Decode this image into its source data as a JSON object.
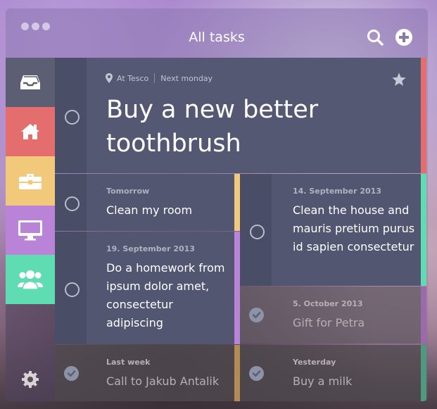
{
  "window": {
    "title": "All tasks"
  },
  "toolbar": {
    "search_icon": "search-icon",
    "add_icon": "plus-circle-icon"
  },
  "sidebar": {
    "items": [
      {
        "name": "inbox",
        "icon": "inbox-icon",
        "color": "#5c5f74"
      },
      {
        "name": "home",
        "icon": "home-icon",
        "color": "#e46e6e"
      },
      {
        "name": "work",
        "icon": "briefcase-icon",
        "color": "#f2c97a"
      },
      {
        "name": "computer",
        "icon": "monitor-icon",
        "color": "#b983d8"
      },
      {
        "name": "people",
        "icon": "group-icon",
        "color": "#60dcb2"
      }
    ],
    "settings_icon": "gear-icon"
  },
  "featured_task": {
    "location": "At Tesco",
    "due": "Next monday",
    "title": "Buy a new better toothbrush",
    "starred": true,
    "color": "#e46e6e"
  },
  "tasks": [
    {
      "id": "t1",
      "date": "Tomorrow",
      "text": "Clean my room",
      "done": false,
      "color": "#f2c97a"
    },
    {
      "id": "t2",
      "date": "14. September 2013",
      "text": "Clean the house and mauris pretium purus id sapien consectetur",
      "done": false,
      "color": "#60dcb2"
    },
    {
      "id": "t3",
      "date": "19. September 2013",
      "text": "Do a homework from ipsum dolor amet, consectetur adipiscing",
      "done": false,
      "color": "#b983d8"
    },
    {
      "id": "t4",
      "date": "5. October 2013",
      "text": "Gift for Petra",
      "done": true,
      "color": "#9b6ba9"
    },
    {
      "id": "t5",
      "date": "Last week",
      "text": "Call to Jakub Antalik",
      "done": true,
      "color": "#b58b54"
    },
    {
      "id": "t6",
      "date": "Yesterday",
      "text": "Buy a milk",
      "done": true,
      "color": "#4f9a7e"
    }
  ]
}
